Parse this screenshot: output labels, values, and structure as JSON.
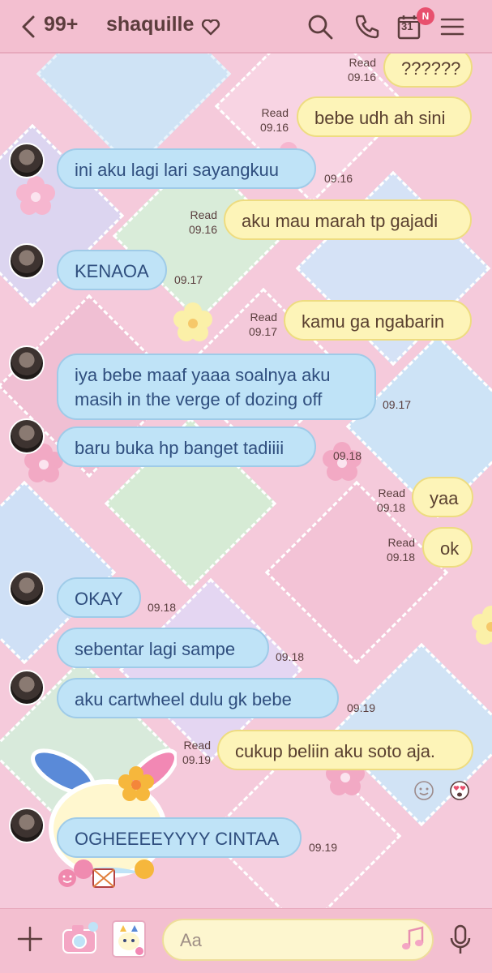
{
  "header": {
    "back_count": "99+",
    "title": "shaquille",
    "calendar_day": "31",
    "notification_badge": "N",
    "icons": [
      "chevron-left-icon",
      "heart-icon",
      "search-icon",
      "call-icon",
      "calendar-icon",
      "menu-icon"
    ]
  },
  "messages": [
    {
      "dir": "out",
      "text": "??????",
      "read": "Read",
      "time": "09.16"
    },
    {
      "dir": "out",
      "text": "bebe udh ah sini",
      "read": "Read",
      "time": "09.16"
    },
    {
      "dir": "in",
      "text": "ini aku lagi lari sayangkuu",
      "time": "09.16"
    },
    {
      "dir": "out",
      "text": "aku mau marah tp gajadi",
      "read": "Read",
      "time": "09.16"
    },
    {
      "dir": "in",
      "text": "KENAOA",
      "time": "09.17"
    },
    {
      "dir": "out",
      "text": "kamu ga ngabarin",
      "read": "Read",
      "time": "09.17"
    },
    {
      "dir": "in",
      "text": "iya bebe maaf yaaa soalnya aku masih in the verge of dozing off",
      "time": "09.17"
    },
    {
      "dir": "in",
      "text": "baru buka hp banget tadiiii",
      "time": "09.18"
    },
    {
      "dir": "out",
      "text": "yaa",
      "read": "Read",
      "time": "09.18"
    },
    {
      "dir": "out",
      "text": "ok",
      "read": "Read",
      "time": "09.18"
    },
    {
      "dir": "in",
      "text": "OKAY",
      "time": "09.18"
    },
    {
      "dir": "in",
      "text": "sebentar lagi sampe",
      "time": "09.18"
    },
    {
      "dir": "in",
      "text": "aku cartwheel dulu gk bebe",
      "time": "09.19"
    },
    {
      "dir": "out",
      "text": "cukup beliin aku soto aja.",
      "read": "Read",
      "time": "09.19"
    },
    {
      "dir": "in",
      "text": "OGHEEEEYYYY CINTAA",
      "time": "09.19"
    }
  ],
  "input": {
    "placeholder": "Aa"
  },
  "colors": {
    "header_bg": "#f3bfd0",
    "incoming_bubble": "#bfe3f7",
    "outgoing_bubble": "#fdf4b8",
    "badge": "#e8506e"
  }
}
